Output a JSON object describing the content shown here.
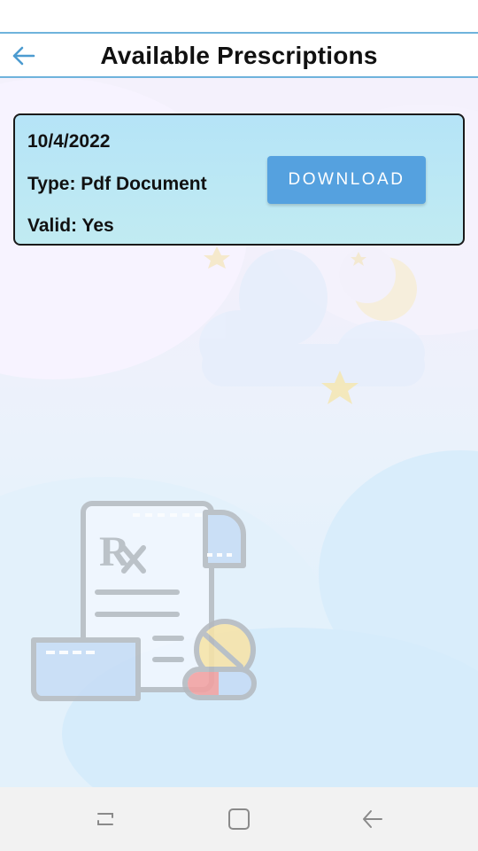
{
  "header": {
    "title": "Available Prescriptions",
    "back_icon": "arrow-left-icon",
    "accent_color": "#6fb3dc"
  },
  "prescriptions": [
    {
      "date": "10/4/2022",
      "type": "Type: Pdf Document",
      "valid": "Valid: Yes",
      "download_label": "DOWNLOAD"
    }
  ],
  "colors": {
    "button": "#55a1df",
    "card_background": "#b5e4f7"
  },
  "nav": {
    "recent_icon": "recent-apps-icon",
    "home_icon": "home-icon",
    "back_icon": "back-icon"
  }
}
